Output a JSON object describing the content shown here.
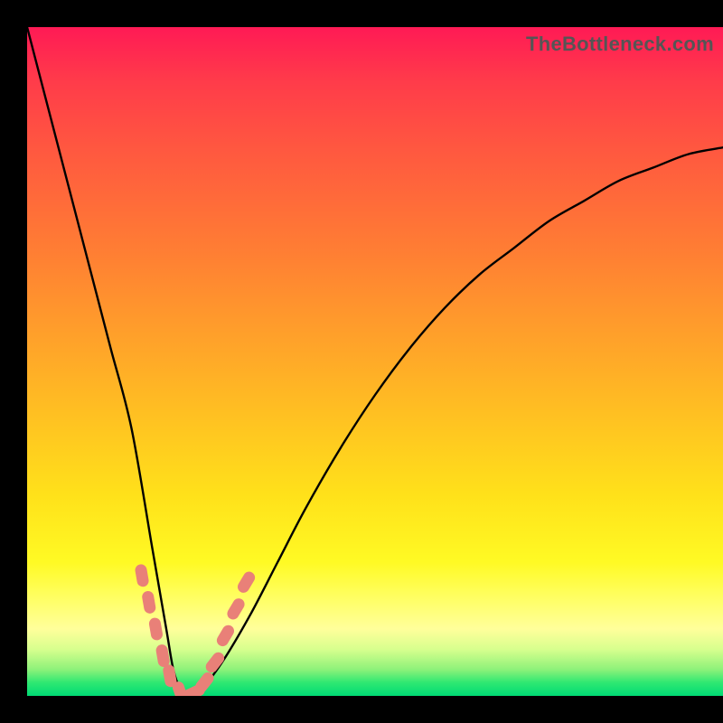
{
  "watermark": "TheBottleneck.com",
  "colors": {
    "frame": "#000000",
    "gradient_top": "#ff1a55",
    "gradient_bottom": "#00da74",
    "curve_stroke": "#000000",
    "marker_fill": "#e98078",
    "marker_stroke": "#e98078"
  },
  "chart_data": {
    "type": "line",
    "title": "",
    "xlabel": "",
    "ylabel": "",
    "xlim": [
      0,
      100
    ],
    "ylim": [
      0,
      100
    ],
    "grid": false,
    "legend": false,
    "annotations": [
      "TheBottleneck.com"
    ],
    "note": "Axes are unlabeled in the original; values are estimated from pixel positions. Y is plotted with 0 at bottom. The curve is a V-shaped bottleneck profile.",
    "series": [
      {
        "name": "bottleneck-curve",
        "x": [
          0,
          3,
          6,
          9,
          12,
          15,
          18,
          20,
          21,
          22,
          23,
          25,
          28,
          32,
          36,
          40,
          45,
          50,
          55,
          60,
          65,
          70,
          75,
          80,
          85,
          90,
          95,
          100
        ],
        "y": [
          100,
          88,
          76,
          64,
          52,
          40,
          22,
          10,
          4,
          1,
          0,
          1,
          5,
          12,
          20,
          28,
          37,
          45,
          52,
          58,
          63,
          67,
          71,
          74,
          77,
          79,
          81,
          82
        ]
      }
    ],
    "markers": {
      "name": "highlighted-band",
      "note": "Salmon lozenge markers clustered near the curve minimum, roughly between y≈2 and y≈18 on both flanks plus the floor.",
      "points": [
        {
          "x": 16.5,
          "y": 18
        },
        {
          "x": 17.5,
          "y": 14
        },
        {
          "x": 18.5,
          "y": 10
        },
        {
          "x": 19.5,
          "y": 6
        },
        {
          "x": 20.5,
          "y": 3
        },
        {
          "x": 22.0,
          "y": 0.5
        },
        {
          "x": 24.0,
          "y": 0.5
        },
        {
          "x": 25.5,
          "y": 2
        },
        {
          "x": 27.0,
          "y": 5
        },
        {
          "x": 28.5,
          "y": 9
        },
        {
          "x": 30.0,
          "y": 13
        },
        {
          "x": 31.5,
          "y": 17
        }
      ]
    }
  }
}
